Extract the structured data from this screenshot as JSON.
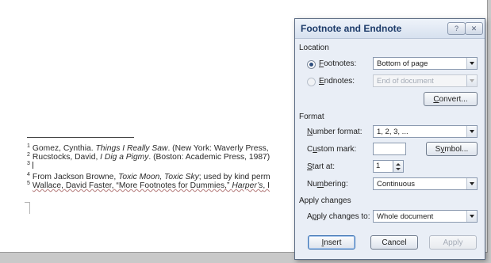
{
  "document": {
    "footnotes": [
      {
        "num": "1",
        "pre": "Gomez, Cynthia. ",
        "italic": "Things I Really Saw",
        "post": ". (New York: Waverly Press,"
      },
      {
        "num": "2",
        "pre": "Rucstocks, David, ",
        "italic": "I Dig a Pigmy",
        "post": ". (Boston: Academic Press, 1987)"
      },
      {
        "num": "3",
        "pre": "",
        "italic": "",
        "post": ""
      },
      {
        "num": "4",
        "pre": "From Jackson Browne, ",
        "italic": "Toxic Moon, Toxic Sky",
        "post": "; used by kind perm"
      },
      {
        "num": "5",
        "pre": "Wallace, David Faster, “More Footnotes for Dummies,” ",
        "italic": "Harper’s",
        "post": ", I"
      }
    ]
  },
  "dialog": {
    "title": "Footnote and Endnote",
    "help_icon": "?",
    "close_icon": "✕",
    "location": {
      "heading": "Location",
      "footnotes": {
        "label_key": "F",
        "label_rest": "ootnotes:",
        "selected": true,
        "value": "Bottom of page"
      },
      "endnotes": {
        "label_key": "E",
        "label_rest": "ndnotes:",
        "selected": false,
        "value": "End of document"
      },
      "convert_key": "C",
      "convert_rest": "onvert..."
    },
    "format": {
      "heading": "Format",
      "number_format": {
        "label_key": "N",
        "label_rest": "umber format:",
        "value": "1, 2, 3, ..."
      },
      "custom_mark": {
        "label_pre": "C",
        "label_key": "u",
        "label_rest": "stom mark:",
        "value": ""
      },
      "symbol_pre": "S",
      "symbol_key": "y",
      "symbol_rest": "mbol...",
      "start_at": {
        "label_key": "S",
        "label_rest": "tart at:",
        "value": "1"
      },
      "numbering": {
        "label_pre": "Nu",
        "label_key": "m",
        "label_rest": "bering:",
        "value": "Continuous"
      }
    },
    "apply": {
      "heading": "Apply changes",
      "apply_to": {
        "label_key": "p",
        "label_pre": "A",
        "label_rest": "ply changes to:",
        "value": "Whole document"
      }
    },
    "buttons": {
      "insert_key": "I",
      "insert_rest": "nsert",
      "cancel": "Cancel",
      "apply": "Apply"
    }
  }
}
